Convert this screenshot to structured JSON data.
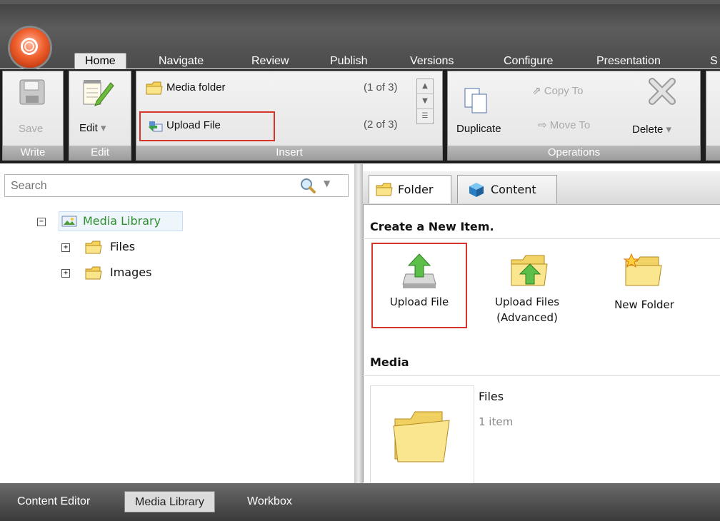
{
  "ribbon_tabs": [
    {
      "label": "Home",
      "active": true
    },
    {
      "label": "Navigate"
    },
    {
      "label": "Review"
    },
    {
      "label": "Publish"
    },
    {
      "label": "Versions"
    },
    {
      "label": "Configure"
    },
    {
      "label": "Presentation"
    },
    {
      "label": "S"
    }
  ],
  "groups": {
    "write": {
      "label": "Write",
      "save": "Save"
    },
    "edit": {
      "label": "Edit",
      "edit": "Edit"
    },
    "insert": {
      "label": "Insert",
      "items": [
        {
          "label": "Media folder",
          "counter": "(1 of 3)"
        },
        {
          "label": "Upload File",
          "counter": "(2 of 3)"
        }
      ]
    },
    "operations": {
      "label": "Operations",
      "duplicate": "Duplicate",
      "copy_to": "Copy To",
      "move_to": "Move To",
      "delete": "Delete"
    }
  },
  "search": {
    "placeholder": "Search"
  },
  "tree": {
    "root": "Media Library",
    "children": [
      "Files",
      "Images"
    ]
  },
  "content_tabs": [
    "Folder",
    "Content"
  ],
  "create_section": {
    "heading": "Create a New Item.",
    "items": [
      {
        "label": "Upload File",
        "icon": "upload-file-icon"
      },
      {
        "label": "Upload Files\n(Advanced)",
        "line1": "Upload Files",
        "line2": "(Advanced)",
        "icon": "upload-files-advanced-icon"
      },
      {
        "label": "New Folder",
        "icon": "new-folder-icon"
      }
    ]
  },
  "media_section": {
    "heading": "Media",
    "items": [
      {
        "name": "Files",
        "count": "1 item"
      }
    ]
  },
  "bottom_tabs": [
    {
      "label": "Content Editor"
    },
    {
      "label": "Media Library",
      "active": true
    },
    {
      "label": "Workbox"
    }
  ],
  "colors": {
    "highlight_border": "#d8352a",
    "tree_root_text": "#2f8f2f"
  }
}
